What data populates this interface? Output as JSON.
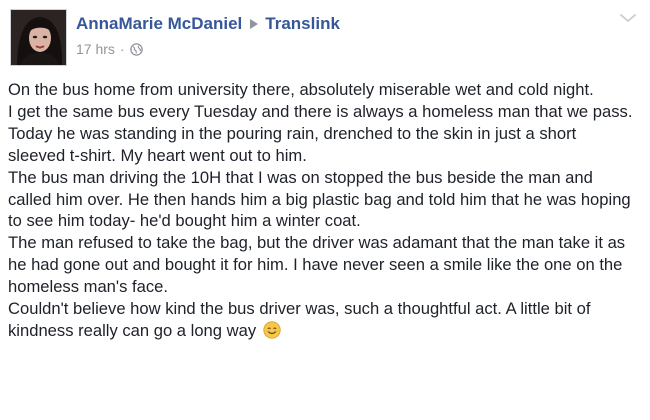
{
  "post": {
    "author": "AnnaMarie McDaniel",
    "target": "Translink",
    "timestamp": "17 hrs",
    "separator": "·",
    "audience_icon": "globe-icon",
    "menu_icon": "chevron-down-icon",
    "paragraphs": [
      "On the bus home from university there, absolutely miserable wet and cold night.",
      "I get the same bus every Tuesday and there is always a homeless man that we pass. Today he was standing in the pouring rain, drenched to the skin in just a short sleeved t-shirt. My heart went out to him.",
      "The bus man driving the 10H that I was on stopped the bus beside the man and called him over. He then hands him a big plastic bag and told him that he was hoping to see him today- he'd bought him a winter coat.",
      "The man refused to take the bag, but the driver was adamant that the man take it as he had gone out and bought it for him. I have never seen a smile like the one on the homeless man's face.",
      "Couldn't believe how kind the bus driver was, such a thoughtful act. A little bit of kindness really can go a long way"
    ],
    "closing_emoji": "smiling-face-emoji"
  },
  "colors": {
    "link": "#365899",
    "text": "#1d2129",
    "meta": "#90949c",
    "emoji": "#f7c84a"
  }
}
